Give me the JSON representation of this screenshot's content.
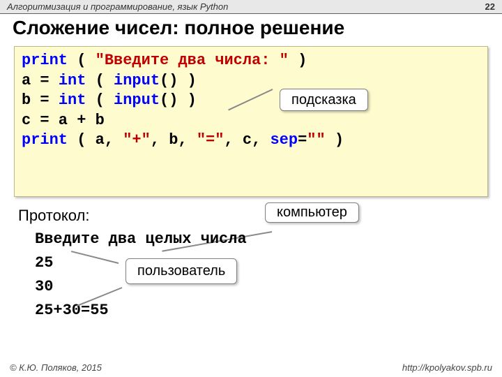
{
  "header": {
    "course": "Алгоритмизация и программирование, язык Python",
    "page_number": "22"
  },
  "title": "Сложение чисел: полное решение",
  "hint_label": "подсказка",
  "code": {
    "l1_a": "print",
    "l1_b": " ( ",
    "l1_c": "\"Введите два числа: \"",
    "l1_d": " )",
    "l2_a": "a = ",
    "l2_b": "int",
    "l2_c": " ( ",
    "l2_d": "input",
    "l2_e": "() )",
    "l3_a": "b = ",
    "l3_b": "int",
    "l3_c": " ( ",
    "l3_d": "input",
    "l3_e": "() )",
    "l4": "c = a + b",
    "l5_a": "print",
    "l5_b": " ( a, ",
    "l5_c": "\"+\"",
    "l5_d": ", b, ",
    "l5_e": "\"=\"",
    "l5_f": ", c, ",
    "l5_g": "sep",
    "l5_h": "=",
    "l5_i": "\"\"",
    "l5_j": " )"
  },
  "protocol": {
    "label": "Протокол:",
    "computer_label": "компьютер",
    "user_label": "пользователь",
    "line1": "Введите два целых числа",
    "line2": "25",
    "line3": "30",
    "line4": "25+30=55"
  },
  "footer": {
    "copyright": "© К.Ю. Поляков, 2015",
    "url": "http://kpolyakov.spb.ru"
  }
}
